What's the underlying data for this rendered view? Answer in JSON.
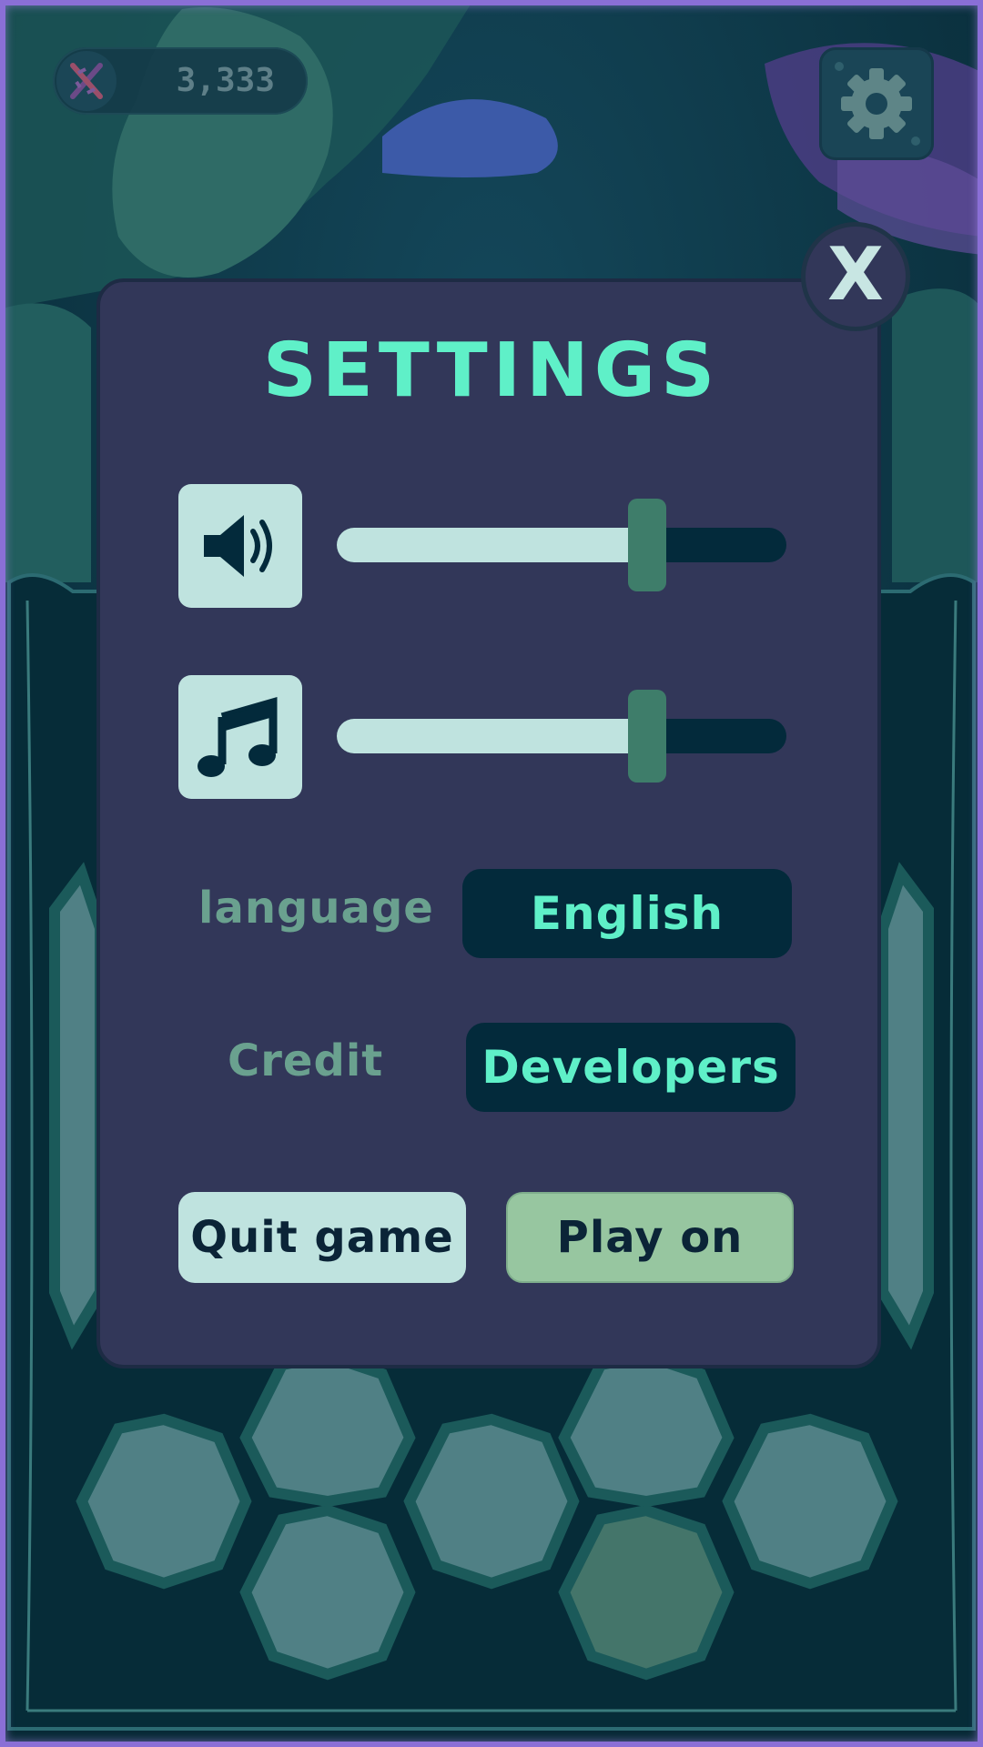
{
  "hud": {
    "currency_icon": "dna-icon",
    "currency_value": "3,333",
    "settings_icon": "gear-icon"
  },
  "settings": {
    "title": "SETTINGS",
    "close_label": "X",
    "sound": {
      "icon": "speaker-icon",
      "level": 0.69
    },
    "music": {
      "icon": "music-note-icon",
      "level": 0.69
    },
    "language": {
      "label": "language",
      "value": "English"
    },
    "credit": {
      "label": "Credit",
      "button": "Developers"
    },
    "quit_button": "Quit game",
    "play_button": "Play on"
  },
  "colors": {
    "modal_bg": "#323759",
    "accent_teal": "#5ff0c8",
    "light_panel": "#bfe3df",
    "dark_button": "#032a3b",
    "play_button": "#97c6a0",
    "slider_thumb": "#3e7d6a",
    "board_tile": "#508085"
  }
}
